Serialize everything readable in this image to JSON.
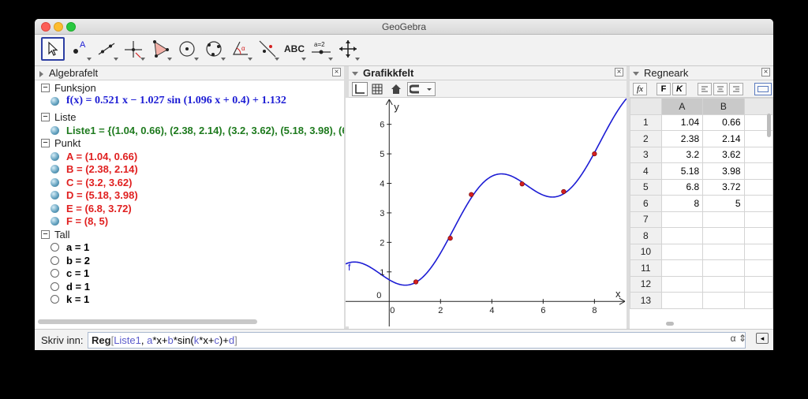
{
  "window": {
    "title": "GeoGebra"
  },
  "toolbar": {
    "tools": [
      {
        "name": "move-tool",
        "label": ""
      },
      {
        "name": "point-tool",
        "label": "A"
      },
      {
        "name": "line-tool",
        "label": ""
      },
      {
        "name": "perpendicular-line-tool",
        "label": ""
      },
      {
        "name": "polygon-tool",
        "label": ""
      },
      {
        "name": "circle-center-point-tool",
        "label": ""
      },
      {
        "name": "circle-three-points-tool",
        "label": ""
      },
      {
        "name": "angle-tool",
        "label": "α"
      },
      {
        "name": "reflect-tool",
        "label": ""
      },
      {
        "name": "text-tool",
        "label": "ABC"
      },
      {
        "name": "slider-tool",
        "label": "a=2"
      },
      {
        "name": "move-graphics-view-tool",
        "label": ""
      }
    ]
  },
  "algebra": {
    "title": "Algebrafelt",
    "categories": [
      {
        "label": "Funksjon",
        "items": [
          {
            "text": "f(x)  =  0.521 x − 1.027  sin (1.096 x + 0.4) + 1.132",
            "color": "#1c1cd4",
            "kind": "function"
          }
        ]
      },
      {
        "label": "Liste",
        "items": [
          {
            "text": "Liste1 = {(1.04, 0.66), (2.38, 2.14), (3.2, 3.62), (5.18, 3.98), (6.8, 3.72), (8, 5)}",
            "color": "#1e7a1e",
            "kind": "list"
          }
        ]
      },
      {
        "label": "Punkt",
        "items": [
          {
            "text": "A = (1.04, 0.66)",
            "color": "#e02020",
            "kind": "point"
          },
          {
            "text": "B = (2.38, 2.14)",
            "color": "#e02020",
            "kind": "point"
          },
          {
            "text": "C = (3.2, 3.62)",
            "color": "#e02020",
            "kind": "point"
          },
          {
            "text": "D = (5.18, 3.98)",
            "color": "#e02020",
            "kind": "point"
          },
          {
            "text": "E = (6.8, 3.72)",
            "color": "#e02020",
            "kind": "point"
          },
          {
            "text": "F = (8, 5)",
            "color": "#e02020",
            "kind": "point"
          }
        ]
      },
      {
        "label": "Tall",
        "items": [
          {
            "text": "a = 1",
            "color": "#111111",
            "kind": "number"
          },
          {
            "text": "b = 2",
            "color": "#111111",
            "kind": "number"
          },
          {
            "text": "c = 1",
            "color": "#111111",
            "kind": "number"
          },
          {
            "text": "d = 1",
            "color": "#111111",
            "kind": "number"
          },
          {
            "text": "k = 1",
            "color": "#111111",
            "kind": "number"
          }
        ]
      }
    ]
  },
  "graphics": {
    "title": "Grafikkfelt",
    "x_label": "x",
    "y_label": "y",
    "origin_label": "0",
    "function_label": "f",
    "x_ticks": [
      "0",
      "2",
      "4",
      "6",
      "8"
    ],
    "y_ticks": [
      "1",
      "2",
      "3",
      "4",
      "5",
      "6"
    ],
    "function": {
      "a": 0.521,
      "b": -1.027,
      "k": 1.096,
      "c": 0.4,
      "d": 1.132,
      "color": "#1c1cd4"
    },
    "points": [
      {
        "x": 1.04,
        "y": 0.66
      },
      {
        "x": 2.38,
        "y": 2.14
      },
      {
        "x": 3.2,
        "y": 3.62
      },
      {
        "x": 5.18,
        "y": 3.98
      },
      {
        "x": 6.8,
        "y": 3.72
      },
      {
        "x": 8,
        "y": 5
      }
    ],
    "point_color": "#d42020",
    "xlim": [
      -1.7,
      9.25
    ],
    "ylim": [
      -0.85,
      6.9
    ]
  },
  "spreadsheet": {
    "title": "Regneark",
    "toolbar": {
      "fx": "fx",
      "bold": "F",
      "italic": "K"
    },
    "columns": [
      "A",
      "B"
    ],
    "rows": [
      {
        "n": "1",
        "a": "1.04",
        "b": "0.66"
      },
      {
        "n": "2",
        "a": "2.38",
        "b": "2.14"
      },
      {
        "n": "3",
        "a": "3.2",
        "b": "3.62"
      },
      {
        "n": "4",
        "a": "5.18",
        "b": "3.98"
      },
      {
        "n": "5",
        "a": "6.8",
        "b": "3.72"
      },
      {
        "n": "6",
        "a": "8",
        "b": "5"
      },
      {
        "n": "7",
        "a": "",
        "b": ""
      },
      {
        "n": "8",
        "a": "",
        "b": ""
      },
      {
        "n": "10",
        "a": "",
        "b": ""
      },
      {
        "n": "11",
        "a": "",
        "b": ""
      },
      {
        "n": "12",
        "a": "",
        "b": ""
      },
      {
        "n": "13",
        "a": "",
        "b": ""
      }
    ]
  },
  "input": {
    "label": "Skriv inn:",
    "command": {
      "fn": "Reg",
      "list": "Liste1",
      "expr_parts": [
        {
          "t": "a",
          "v": true
        },
        {
          "t": "*x+",
          "v": false
        },
        {
          "t": "b",
          "v": true
        },
        {
          "t": "*sin(",
          "v": false
        },
        {
          "t": "k",
          "v": true
        },
        {
          "t": "*x+",
          "v": false
        },
        {
          "t": "c",
          "v": true
        },
        {
          "t": ")+",
          "v": false
        },
        {
          "t": "d",
          "v": true
        }
      ]
    },
    "alpha": "α"
  }
}
